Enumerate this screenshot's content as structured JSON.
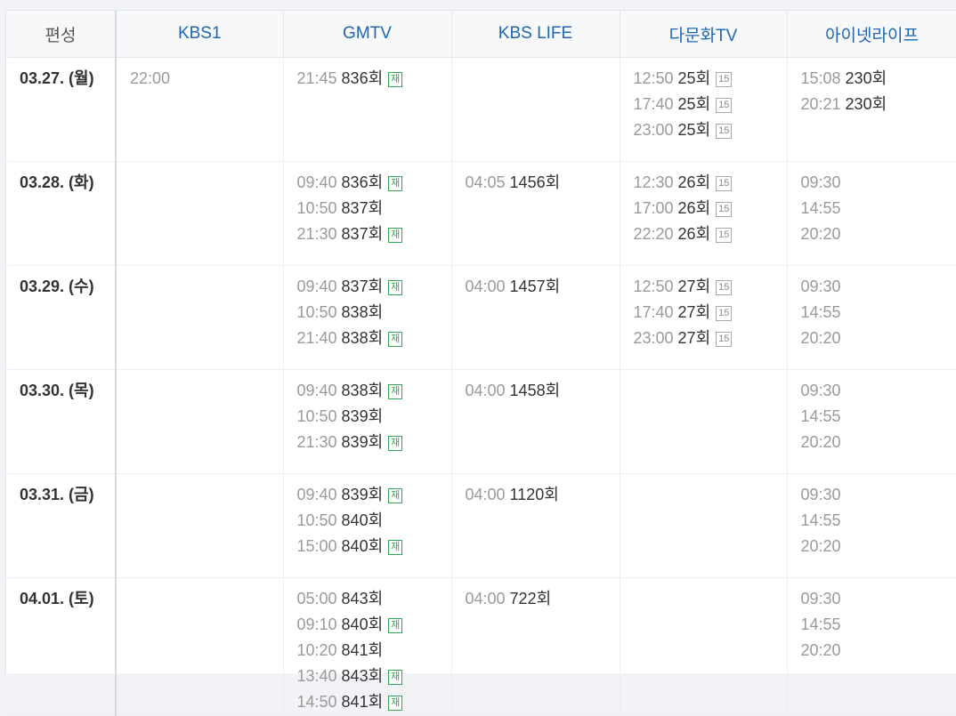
{
  "table": {
    "corner_label": "편성",
    "channels": [
      "KBS1",
      "GMTV",
      "KBS LIFE",
      "다문화TV",
      "아이넷라이프"
    ],
    "rows": [
      {
        "date": "03.27. (월)",
        "cells": [
          [
            {
              "time": "22:00",
              "episode": "",
              "badge": ""
            }
          ],
          [
            {
              "time": "21:45",
              "episode": "836회",
              "badge": "재"
            }
          ],
          [],
          [
            {
              "time": "12:50",
              "episode": "25회",
              "badge": "15"
            },
            {
              "time": "17:40",
              "episode": "25회",
              "badge": "15"
            },
            {
              "time": "23:00",
              "episode": "25회",
              "badge": "15"
            }
          ],
          [
            {
              "time": "15:08",
              "episode": "230회",
              "badge": ""
            },
            {
              "time": "20:21",
              "episode": "230회",
              "badge": ""
            }
          ]
        ]
      },
      {
        "date": "03.28. (화)",
        "cells": [
          [],
          [
            {
              "time": "09:40",
              "episode": "836회",
              "badge": "재"
            },
            {
              "time": "10:50",
              "episode": "837회",
              "badge": ""
            },
            {
              "time": "21:30",
              "episode": "837회",
              "badge": "재"
            }
          ],
          [
            {
              "time": "04:05",
              "episode": "1456회",
              "badge": ""
            }
          ],
          [
            {
              "time": "12:30",
              "episode": "26회",
              "badge": "15"
            },
            {
              "time": "17:00",
              "episode": "26회",
              "badge": "15"
            },
            {
              "time": "22:20",
              "episode": "26회",
              "badge": "15"
            }
          ],
          [
            {
              "time": "09:30",
              "episode": "",
              "badge": ""
            },
            {
              "time": "14:55",
              "episode": "",
              "badge": ""
            },
            {
              "time": "20:20",
              "episode": "",
              "badge": ""
            }
          ]
        ]
      },
      {
        "date": "03.29. (수)",
        "cells": [
          [],
          [
            {
              "time": "09:40",
              "episode": "837회",
              "badge": "재"
            },
            {
              "time": "10:50",
              "episode": "838회",
              "badge": ""
            },
            {
              "time": "21:40",
              "episode": "838회",
              "badge": "재"
            }
          ],
          [
            {
              "time": "04:00",
              "episode": "1457회",
              "badge": ""
            }
          ],
          [
            {
              "time": "12:50",
              "episode": "27회",
              "badge": "15"
            },
            {
              "time": "17:40",
              "episode": "27회",
              "badge": "15"
            },
            {
              "time": "23:00",
              "episode": "27회",
              "badge": "15"
            }
          ],
          [
            {
              "time": "09:30",
              "episode": "",
              "badge": ""
            },
            {
              "time": "14:55",
              "episode": "",
              "badge": ""
            },
            {
              "time": "20:20",
              "episode": "",
              "badge": ""
            }
          ]
        ]
      },
      {
        "date": "03.30. (목)",
        "cells": [
          [],
          [
            {
              "time": "09:40",
              "episode": "838회",
              "badge": "재"
            },
            {
              "time": "10:50",
              "episode": "839회",
              "badge": ""
            },
            {
              "time": "21:30",
              "episode": "839회",
              "badge": "재"
            }
          ],
          [
            {
              "time": "04:00",
              "episode": "1458회",
              "badge": ""
            }
          ],
          [],
          [
            {
              "time": "09:30",
              "episode": "",
              "badge": ""
            },
            {
              "time": "14:55",
              "episode": "",
              "badge": ""
            },
            {
              "time": "20:20",
              "episode": "",
              "badge": ""
            }
          ]
        ]
      },
      {
        "date": "03.31. (금)",
        "cells": [
          [],
          [
            {
              "time": "09:40",
              "episode": "839회",
              "badge": "재"
            },
            {
              "time": "10:50",
              "episode": "840회",
              "badge": ""
            },
            {
              "time": "15:00",
              "episode": "840회",
              "badge": "재"
            }
          ],
          [
            {
              "time": "04:00",
              "episode": "1120회",
              "badge": ""
            }
          ],
          [],
          [
            {
              "time": "09:30",
              "episode": "",
              "badge": ""
            },
            {
              "time": "14:55",
              "episode": "",
              "badge": ""
            },
            {
              "time": "20:20",
              "episode": "",
              "badge": ""
            }
          ]
        ]
      },
      {
        "date": "04.01. (토)",
        "cells": [
          [],
          [
            {
              "time": "05:00",
              "episode": "843회",
              "badge": ""
            },
            {
              "time": "09:10",
              "episode": "840회",
              "badge": "재"
            },
            {
              "time": "10:20",
              "episode": "841회",
              "badge": ""
            },
            {
              "time": "13:40",
              "episode": "843회",
              "badge": "재"
            },
            {
              "time": "14:50",
              "episode": "841회",
              "badge": "재"
            }
          ],
          [
            {
              "time": "04:00",
              "episode": "722회",
              "badge": ""
            }
          ],
          [],
          [
            {
              "time": "09:30",
              "episode": "",
              "badge": ""
            },
            {
              "time": "14:55",
              "episode": "",
              "badge": ""
            },
            {
              "time": "20:20",
              "episode": "",
              "badge": ""
            }
          ]
        ]
      }
    ]
  }
}
